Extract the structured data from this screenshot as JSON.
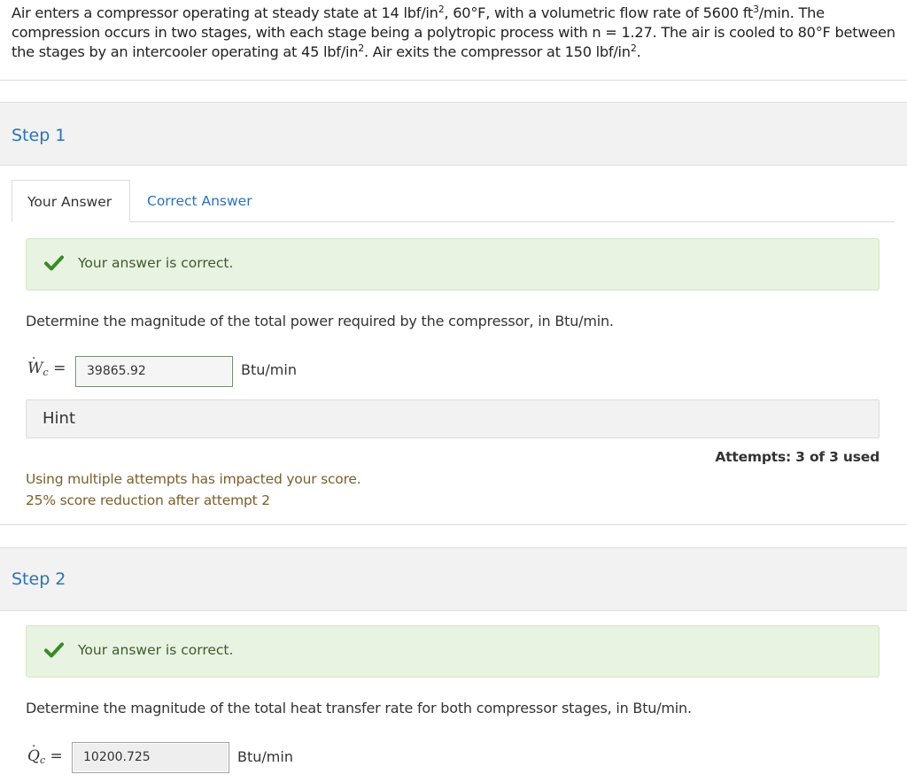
{
  "problem": {
    "part1": "Air enters a compressor operating at steady state at 14 lbf/in",
    "sup1": "2",
    "part2": ", 60°F, with a volumetric flow rate of 5600 ft",
    "sup2": "3",
    "part3": "/min. The compression occurs in two stages, with each stage being a polytropic process with n = 1.27. The air is cooled to 80°F between the stages by an intercooler operating at 45 lbf/in",
    "sup3": "2",
    "part4": ". Air exits the compressor at 150 lbf/in",
    "sup4": "2",
    "part5": "."
  },
  "step1": {
    "title": "Step 1",
    "tabs": [
      "Your Answer",
      "Correct Answer"
    ],
    "alert": "Your answer is correct.",
    "question": "Determine the magnitude of the total power required by the compressor, in Btu/min.",
    "symbol": "W",
    "subscript": "c",
    "equals": "=",
    "value": "39865.92",
    "units": "Btu/min",
    "hint": "Hint",
    "attempts": "Attempts: 3 of 3 used",
    "penalty_line1": "Using multiple attempts has impacted your score.",
    "penalty_line2": "25% score reduction after attempt 2"
  },
  "step2": {
    "title": "Step 2",
    "alert": "Your answer is correct.",
    "question": "Determine the magnitude of the total heat transfer rate for both compressor stages, in Btu/min.",
    "symbol": "Q",
    "subscript": "c",
    "equals": "=",
    "value": "10200.725",
    "units": "Btu/min"
  },
  "colors": {
    "link": "#2b72b8",
    "success_bg": "#e8f3e1",
    "success_check": "#3a8a2a",
    "penalty_text": "#7a5e2c"
  },
  "icons": {
    "check": "check-icon"
  }
}
